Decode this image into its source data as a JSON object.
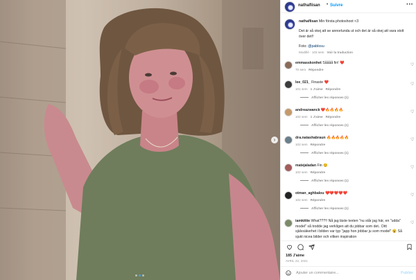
{
  "post": {
    "author": "nathaflisan",
    "separator": "•",
    "follow_label": "Suivre",
    "more_icon": "more-horizontal-icon"
  },
  "caption": {
    "username": "nathaflisan",
    "line1": "Min första photoshoot <3",
    "line2": "Det är så okej att se annorlunda ut och det är så okej att vara stolt över det!!",
    "photo_credit_prefix": "Foto: ",
    "photo_credit_handle": "@pablosu",
    "edited": "Modifié · 103 sem",
    "see_translation": "Voir la traduction"
  },
  "comments": [
    {
      "username": "emmasskonhet",
      "text": "Såååå fin! ❤️",
      "time": "70 sem",
      "likes": "",
      "reply": "Répondre",
      "view_replies": "",
      "avatar_color": "#8a6b5a"
    },
    {
      "username": "lee_021_",
      "text": "Finaste ❤️",
      "time": "101 sem",
      "likes": "1 J'aime",
      "reply": "Répondre",
      "view_replies": "Afficher les réponses (1)",
      "avatar_color": "#3b3b3b"
    },
    {
      "username": "andreazwanck",
      "text": "❤️🔥🔥🔥🔥",
      "time": "102 sem",
      "likes": "1 J'aime",
      "reply": "Répondre",
      "view_replies": "Afficher les réponses (1)",
      "avatar_color": "#c49a6c"
    },
    {
      "username": "dra.natashabraun",
      "text": "🔥🔥🔥🔥🔥",
      "time": "102 sem",
      "likes": "",
      "reply": "Répondre",
      "view_replies": "Afficher les réponses (1)",
      "avatar_color": "#6b7f8a"
    },
    {
      "username": "matejaladan",
      "text": "Fin 😊",
      "time": "102 sem",
      "likes": "",
      "reply": "Répondre",
      "view_replies": "Afficher les réponses (1)",
      "avatar_color": "#a35c5c"
    },
    {
      "username": "otman_aghbalou",
      "text": "❤️❤️❤️❤️❤️",
      "time": "102 sem",
      "likes": "",
      "reply": "Répondre",
      "view_replies": "Afficher les réponses (1)",
      "avatar_color": "#222222"
    },
    {
      "username": "iamkittie",
      "text": "What???!! Nå jag läste texten \"nu står jag här, en \"udda\" model\" så trodde jag verkligen att du jobbar som det.. Ditt självsäkerhet i bilden var typ \"japp hon jobbar ju som model\" 😮 Så sjukt nicea bilder och vilken inspiration",
      "time": "",
      "likes": "",
      "reply": "",
      "view_replies": "",
      "avatar_color": "#7b8b6a"
    }
  ],
  "actions": {
    "like_icon": "heart-icon",
    "comment_icon": "comment-icon",
    "share_icon": "share-icon",
    "save_icon": "bookmark-icon"
  },
  "likes_count": "185 J'aime",
  "date": "AVRIL 22, 2021",
  "add_comment": {
    "placeholder": "Ajouter un commentaire...",
    "post_label": "Publier",
    "emoji_icon": "emoji-icon"
  },
  "carousel": {
    "next_icon": "chevron-right-icon",
    "slides": 3,
    "active_slide": 2
  },
  "colors": {
    "link_blue": "#0095f6",
    "muted": "#8e8e8e",
    "border": "#efefef"
  }
}
